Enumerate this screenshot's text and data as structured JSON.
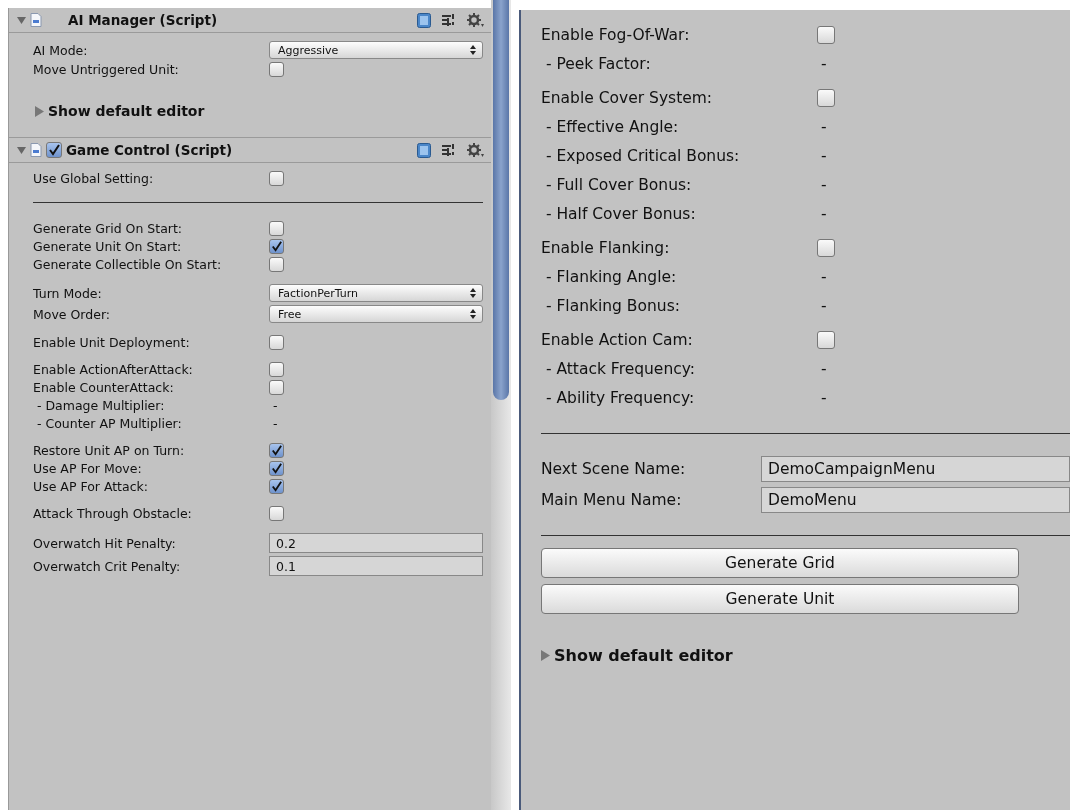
{
  "left_panel": {
    "components": [
      {
        "title": "AI Manager (Script)",
        "expanded": true,
        "groups": [
          {
            "kind": "fields",
            "fields": [
              {
                "kind": "dropdown",
                "label": "AI Mode:",
                "value": "Aggressive"
              },
              {
                "kind": "checkbox",
                "label": "Move Untriggered Unit:",
                "checked": false
              }
            ]
          }
        ],
        "footer": "Show default editor"
      },
      {
        "title": "Game Control (Script)",
        "expanded": true,
        "enabled": true,
        "groups": [
          {
            "kind": "fields",
            "fields": [
              {
                "kind": "checkbox",
                "label": "Use Global Setting:",
                "checked": false
              }
            ]
          },
          {
            "kind": "divider"
          },
          {
            "kind": "fields",
            "fields": [
              {
                "kind": "checkbox",
                "label": "Generate Grid On Start:",
                "checked": false
              },
              {
                "kind": "checkbox",
                "label": "Generate Unit On Start:",
                "checked": true
              },
              {
                "kind": "checkbox",
                "label": "Generate Collectible On Start:",
                "checked": false
              }
            ]
          },
          {
            "kind": "fields",
            "fields": [
              {
                "kind": "dropdown",
                "label": "Turn Mode:",
                "value": "FactionPerTurn"
              },
              {
                "kind": "dropdown",
                "label": "Move Order:",
                "value": "Free"
              }
            ]
          },
          {
            "kind": "fields",
            "fields": [
              {
                "kind": "checkbox",
                "label": "Enable Unit Deployment:",
                "checked": false
              }
            ]
          },
          {
            "kind": "fields",
            "fields": [
              {
                "kind": "checkbox",
                "label": "Enable ActionAfterAttack:",
                "checked": false
              },
              {
                "kind": "checkbox",
                "label": "Enable CounterAttack:",
                "checked": false
              },
              {
                "kind": "readonly",
                "label": " - Damage Multiplier:",
                "value": "-"
              },
              {
                "kind": "readonly",
                "label": " - Counter AP Multiplier:",
                "value": "-"
              }
            ]
          },
          {
            "kind": "fields",
            "fields": [
              {
                "kind": "checkbox",
                "label": "Restore Unit AP on Turn:",
                "checked": true
              },
              {
                "kind": "checkbox",
                "label": "Use AP For Move:",
                "checked": true
              },
              {
                "kind": "checkbox",
                "label": "Use AP For Attack:",
                "checked": true
              }
            ]
          },
          {
            "kind": "fields",
            "fields": [
              {
                "kind": "checkbox",
                "label": "Attack Through Obstacle:",
                "checked": false
              }
            ]
          },
          {
            "kind": "fields",
            "fields": [
              {
                "kind": "text",
                "label": "Overwatch Hit Penalty:",
                "value": "0.2"
              },
              {
                "kind": "text",
                "label": "Overwatch Crit Penalty:",
                "value": "0.1"
              }
            ]
          }
        ]
      }
    ]
  },
  "right_panel": {
    "groups": [
      {
        "kind": "fields",
        "fields": [
          {
            "kind": "checkbox",
            "label": "Enable Fog-Of-War:",
            "checked": false
          },
          {
            "kind": "readonly",
            "label": " - Peek Factor:",
            "value": "-"
          }
        ]
      },
      {
        "kind": "fields",
        "fields": [
          {
            "kind": "checkbox",
            "label": "Enable Cover System:",
            "checked": false
          },
          {
            "kind": "readonly",
            "label": " - Effective Angle:",
            "value": "-"
          },
          {
            "kind": "readonly",
            "label": " - Exposed Critical Bonus:",
            "value": "-"
          },
          {
            "kind": "readonly",
            "label": " - Full Cover Bonus:",
            "value": "-"
          },
          {
            "kind": "readonly",
            "label": " - Half Cover Bonus:",
            "value": "-"
          }
        ]
      },
      {
        "kind": "fields",
        "fields": [
          {
            "kind": "checkbox",
            "label": "Enable Flanking:",
            "checked": false
          },
          {
            "kind": "readonly",
            "label": " - Flanking Angle:",
            "value": "-"
          },
          {
            "kind": "readonly",
            "label": " - Flanking Bonus:",
            "value": "-"
          }
        ]
      },
      {
        "kind": "fields",
        "fields": [
          {
            "kind": "checkbox",
            "label": "Enable Action Cam:",
            "checked": false
          },
          {
            "kind": "readonly",
            "label": " - Attack Frequency:",
            "value": "-"
          },
          {
            "kind": "readonly",
            "label": " - Ability Frequency:",
            "value": "-"
          }
        ]
      },
      {
        "kind": "divider"
      },
      {
        "kind": "fields",
        "fields": [
          {
            "kind": "text",
            "label": "Next Scene Name:",
            "value": "DemoCampaignMenu"
          },
          {
            "kind": "text",
            "label": "Main Menu Name:",
            "value": "DemoMenu"
          }
        ]
      },
      {
        "kind": "divider"
      }
    ],
    "buttons": [
      "Generate Grid",
      "Generate Unit"
    ],
    "footer": "Show default editor"
  }
}
